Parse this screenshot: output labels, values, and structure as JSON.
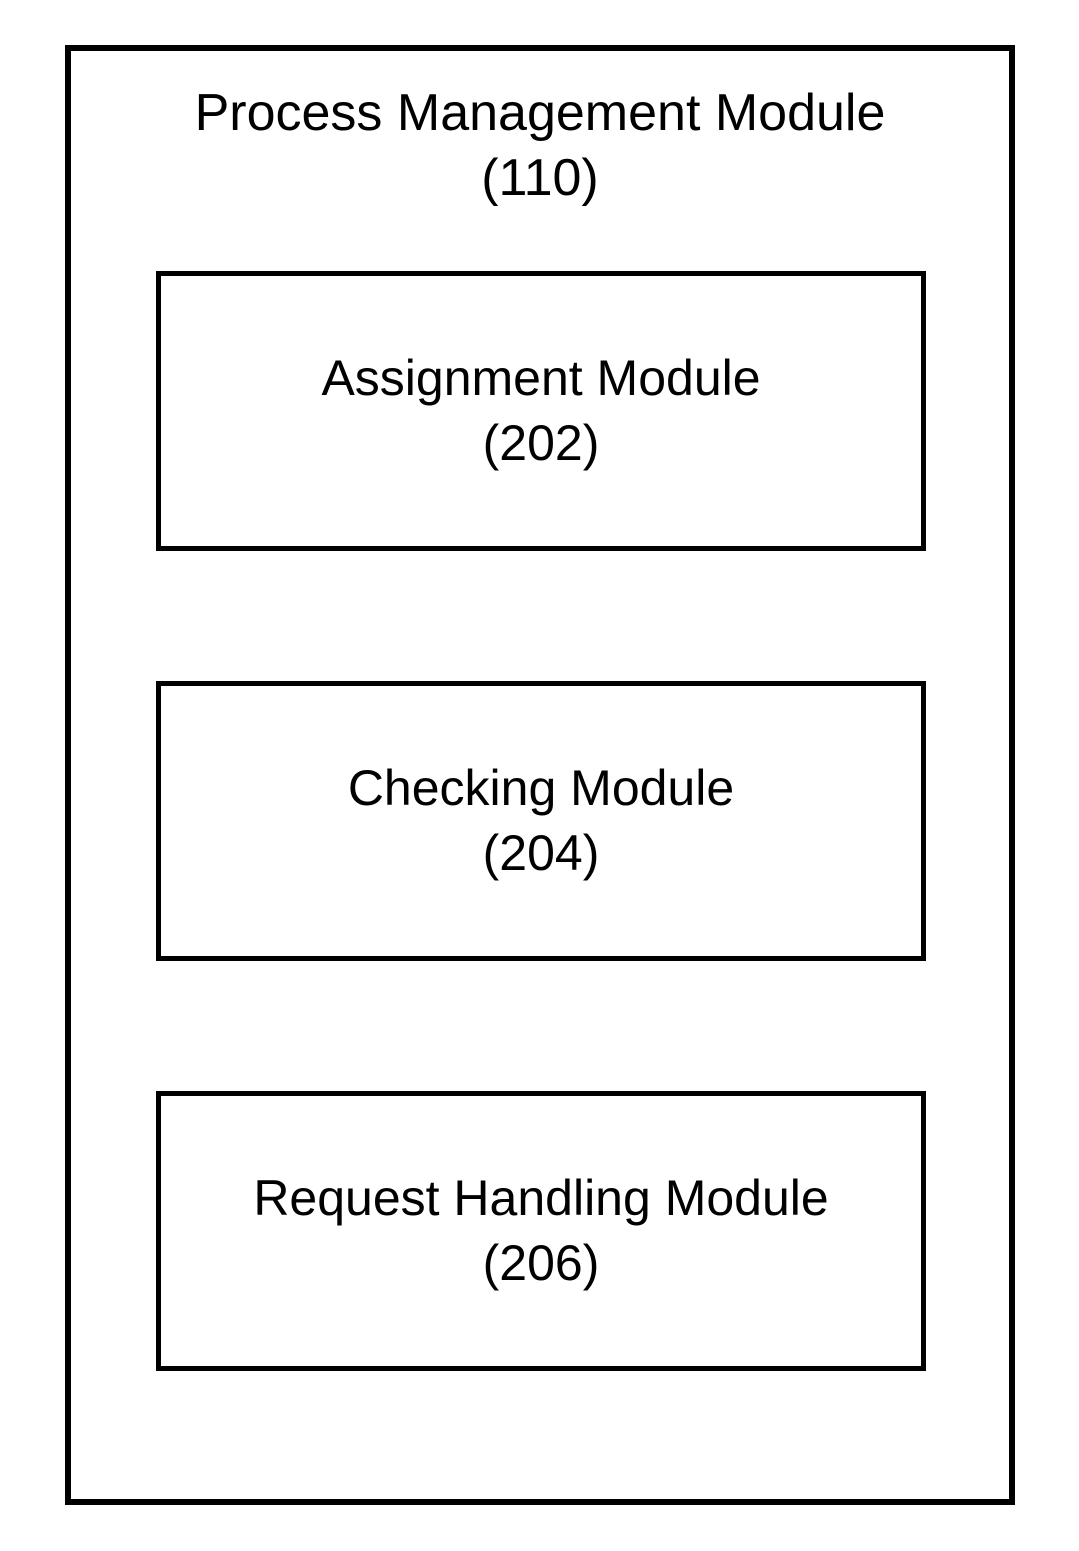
{
  "outer": {
    "title_line1": "Process Management Module",
    "title_line2": "(110)"
  },
  "boxes": [
    {
      "title": "Assignment Module",
      "ref": "(202)"
    },
    {
      "title": "Checking Module",
      "ref": "(204)"
    },
    {
      "title": "Request Handling Module",
      "ref": "(206)"
    }
  ]
}
